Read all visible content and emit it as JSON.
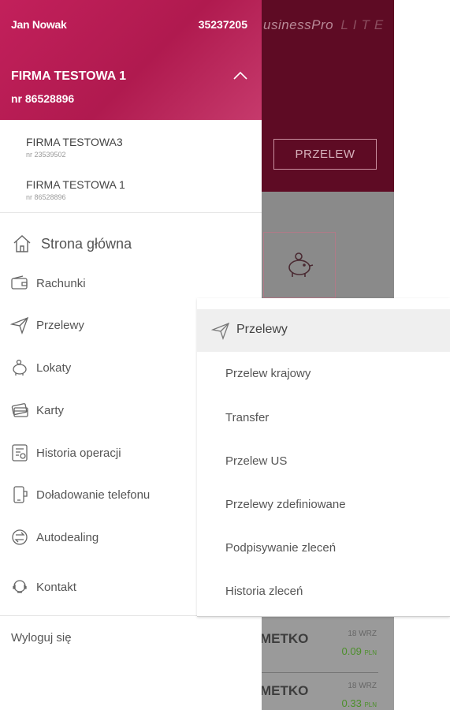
{
  "background_app": {
    "brand": "usiness",
    "brand_pro": "Pro",
    "brand_lite": "LITE",
    "action_button": "PRZELEW",
    "transactions": [
      {
        "title": "METKO",
        "date": "18 WRZ",
        "amount": "0.09",
        "currency": "PLN"
      },
      {
        "title": "METKO",
        "date": "18 WRZ",
        "amount": "0.33",
        "currency": "PLN"
      }
    ]
  },
  "drawer": {
    "user_name": "Jan Nowak",
    "user_id": "35237205",
    "company_name": "FIRMA TESTOWA 1",
    "company_nr": "nr 86528896",
    "companies": [
      {
        "name": "FIRMA TESTOWA3",
        "nr": "nr 23539502"
      },
      {
        "name": "FIRMA TESTOWA 1",
        "nr": "nr 86528896"
      }
    ],
    "menu": [
      {
        "label": "Strona główna",
        "icon": "home-icon"
      },
      {
        "label": "Rachunki",
        "icon": "wallet-icon"
      },
      {
        "label": "Przelewy",
        "icon": "send-icon"
      },
      {
        "label": "Lokaty",
        "icon": "piggy-bank-icon"
      },
      {
        "label": "Karty",
        "icon": "card-icon"
      },
      {
        "label": "Historia operacji",
        "icon": "history-icon"
      },
      {
        "label": "Doładowanie telefonu",
        "icon": "phone-icon"
      },
      {
        "label": "Autodealing",
        "icon": "exchange-icon"
      },
      {
        "label": "Kontakt",
        "icon": "contact-icon"
      }
    ],
    "logout": "Wyloguj się"
  },
  "submenu": {
    "title": "Przelewy",
    "items": [
      "Przelew krajowy",
      "Transfer",
      "Przelew US",
      "Przelewy zdefiniowane",
      "Podpisywanie zleceń",
      "Historia zleceń"
    ]
  },
  "colors": {
    "header_accent": "#c2205b",
    "background_header": "#5e0b24",
    "amount_green": "#4c8f2a"
  }
}
